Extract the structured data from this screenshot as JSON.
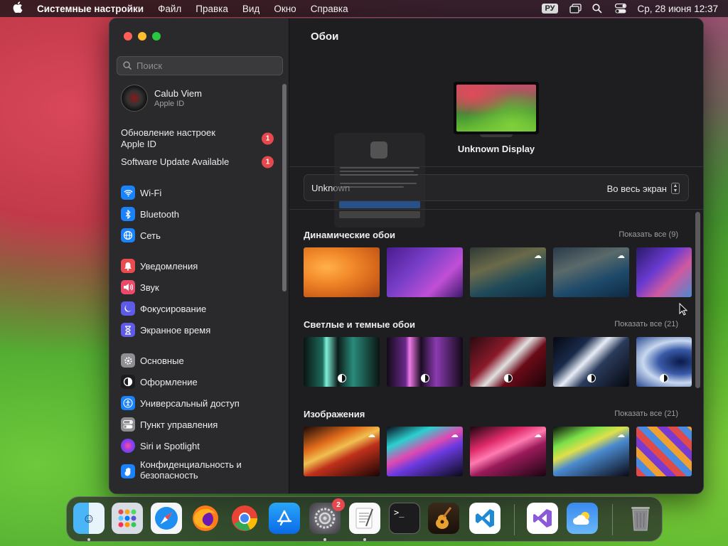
{
  "menubar": {
    "apple": "",
    "app_name": "Системные настройки",
    "menus": [
      "Файл",
      "Правка",
      "Вид",
      "Окно",
      "Справка"
    ],
    "input_source": "РУ",
    "datetime": "Ср, 28 июня  12:37"
  },
  "sidebar": {
    "search_placeholder": "Поиск",
    "user": {
      "name": "Calub Viem",
      "subtitle": "Apple ID"
    },
    "notices": [
      {
        "label": "Обновление настроек Apple ID",
        "badge": "1"
      },
      {
        "label": "Software Update Available",
        "badge": "1"
      }
    ],
    "items": [
      {
        "label": "Wi-Fi",
        "icon": "wifi-icon",
        "color": "#1a82fb"
      },
      {
        "label": "Bluetooth",
        "icon": "bluetooth-icon",
        "color": "#1a82fb"
      },
      {
        "label": "Сеть",
        "icon": "globe-icon",
        "color": "#1a82fb"
      },
      {
        "label": "Уведомления",
        "icon": "bell-icon",
        "color": "#ea4b4f"
      },
      {
        "label": "Звук",
        "icon": "speaker-icon",
        "color": "#ea4b6b"
      },
      {
        "label": "Фокусирование",
        "icon": "moon-icon",
        "color": "#5e5ce6"
      },
      {
        "label": "Экранное время",
        "icon": "hourglass-icon",
        "color": "#5e5ce6"
      },
      {
        "label": "Основные",
        "icon": "gear-icon",
        "color": "#8e8e93"
      },
      {
        "label": "Оформление",
        "icon": "appearance-icon",
        "color": "#1c1c1e"
      },
      {
        "label": "Универсальный доступ",
        "icon": "accessibility-icon",
        "color": "#1a82fb"
      },
      {
        "label": "Пункт управления",
        "icon": "control-center-icon",
        "color": "#8e8e93"
      },
      {
        "label": "Siri и Spotlight",
        "icon": "siri-icon",
        "color": "#b03ae0"
      },
      {
        "label": "Конфиденциальность и безопасность",
        "icon": "hand-icon",
        "color": "#1a82fb"
      }
    ]
  },
  "main": {
    "title": "Обои",
    "display_name": "Unknown Display",
    "selector": {
      "left": "Unknown",
      "right": "Во весь экран"
    },
    "sections": [
      {
        "title": "Динамические обои",
        "show_all": "Показать все (9)"
      },
      {
        "title": "Светлые и темные обои",
        "show_all": "Показать все (21)"
      },
      {
        "title": "Изображения",
        "show_all": "Показать все (21)"
      }
    ]
  },
  "dock": {
    "apps": [
      "Finder",
      "Launchpad",
      "Safari",
      "Firefox",
      "Chrome",
      "App Store",
      "Системные настройки",
      "TextEdit",
      "Терминал",
      "GarageBand",
      "Visual Studio Code",
      "Visual Studio",
      "Погода",
      "Корзина"
    ],
    "settings_badge": "2"
  }
}
